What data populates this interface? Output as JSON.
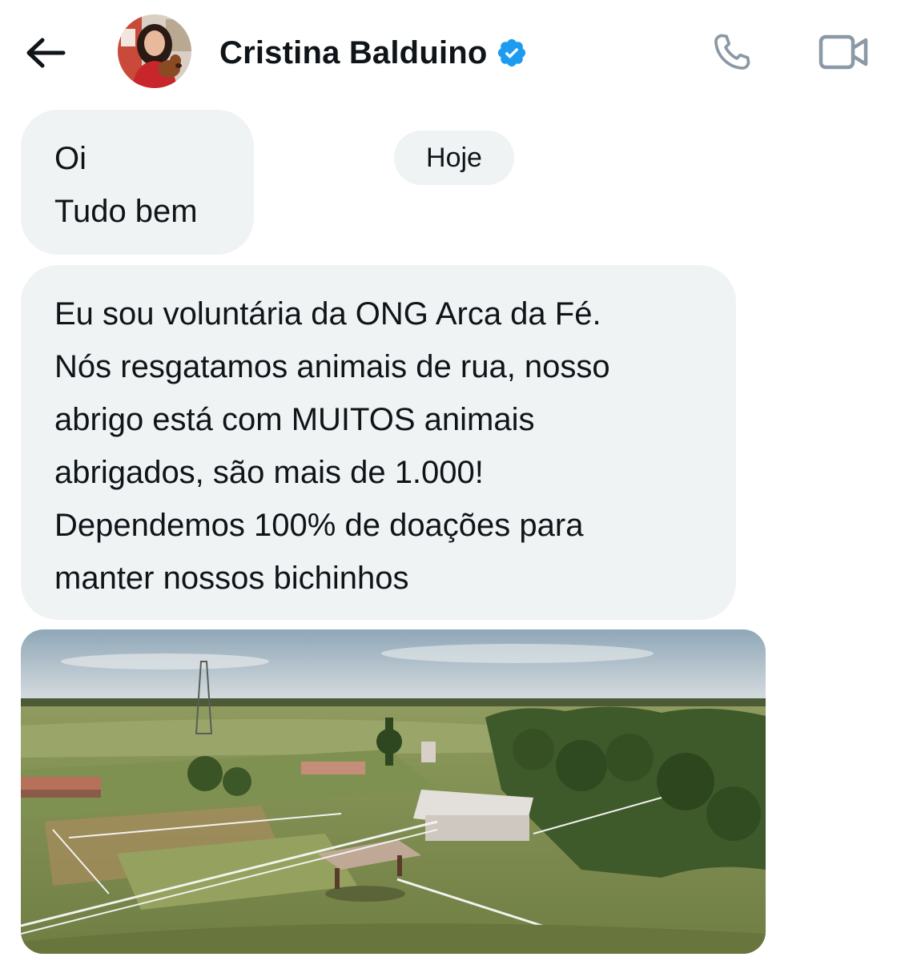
{
  "header": {
    "back_icon": "arrow-left-icon",
    "contact_name": "Cristina Balduino",
    "verified_icon": "verified-badge-icon",
    "call_icon": "phone-icon",
    "video_icon": "video-camera-icon",
    "colors": {
      "verified": "#1d9bf0",
      "icon_gray": "#8b98a5"
    }
  },
  "conversation": {
    "date_divider": "Hoje",
    "messages": [
      {
        "lines": [
          "Oi",
          "Tudo bem"
        ]
      },
      {
        "lines": [
          "Eu sou voluntária da ONG Arca da Fé.",
          "Nós resgatamos animais de rua, nosso",
          "abrigo está com MUITOS animais",
          "abrigados, são mais de 1.000!",
          "Dependemos 100% de doações para",
          "manter nossos bichinhos"
        ]
      }
    ],
    "bubble_color": "#eff3f4"
  }
}
